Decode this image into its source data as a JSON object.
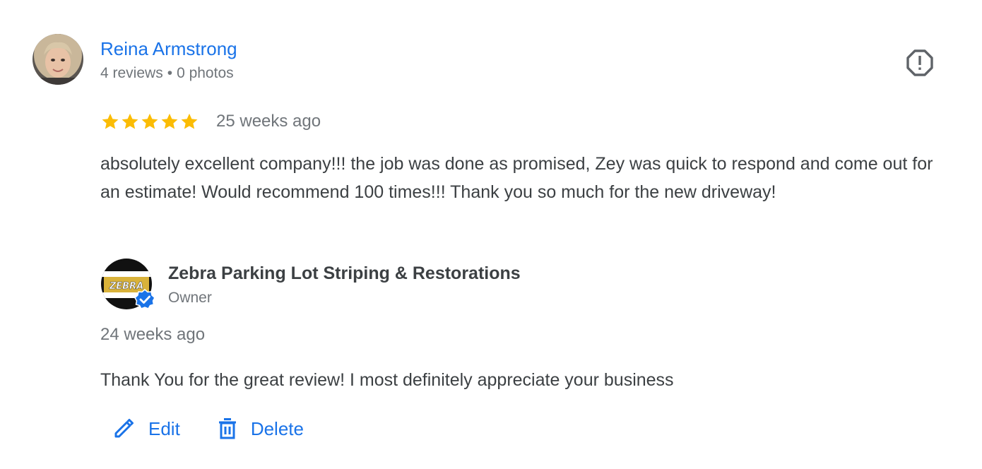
{
  "review": {
    "reviewer": {
      "name": "Reina Armstrong",
      "reviews": "4 reviews",
      "separator": "•",
      "photos": "0 photos"
    },
    "rating": 5,
    "rating_max": 5,
    "time": "25 weeks ago",
    "text": "absolutely excellent company!!! the job was done as promised, Zey was quick to respond and come out for an estimate! Would recommend 100 times!!! Thank you so much for the new driveway!"
  },
  "owner_reply": {
    "name": "Zebra Parking Lot Striping & Restorations",
    "role": "Owner",
    "logo_text": "ZEBRA",
    "time": "24 weeks ago",
    "text": "Thank You for the great review! I most definitely appreciate your business"
  },
  "actions": {
    "edit_label": "Edit",
    "delete_label": "Delete"
  },
  "icons": {
    "flag": "report-flag-icon",
    "star": "star-icon",
    "edit": "pencil-icon",
    "delete": "trash-icon",
    "verified": "verified-badge-icon"
  },
  "colors": {
    "link": "#1a73e8",
    "star": "#fbbc04",
    "text": "#3c4043",
    "muted": "#70757a",
    "flag": "#5f6368"
  }
}
